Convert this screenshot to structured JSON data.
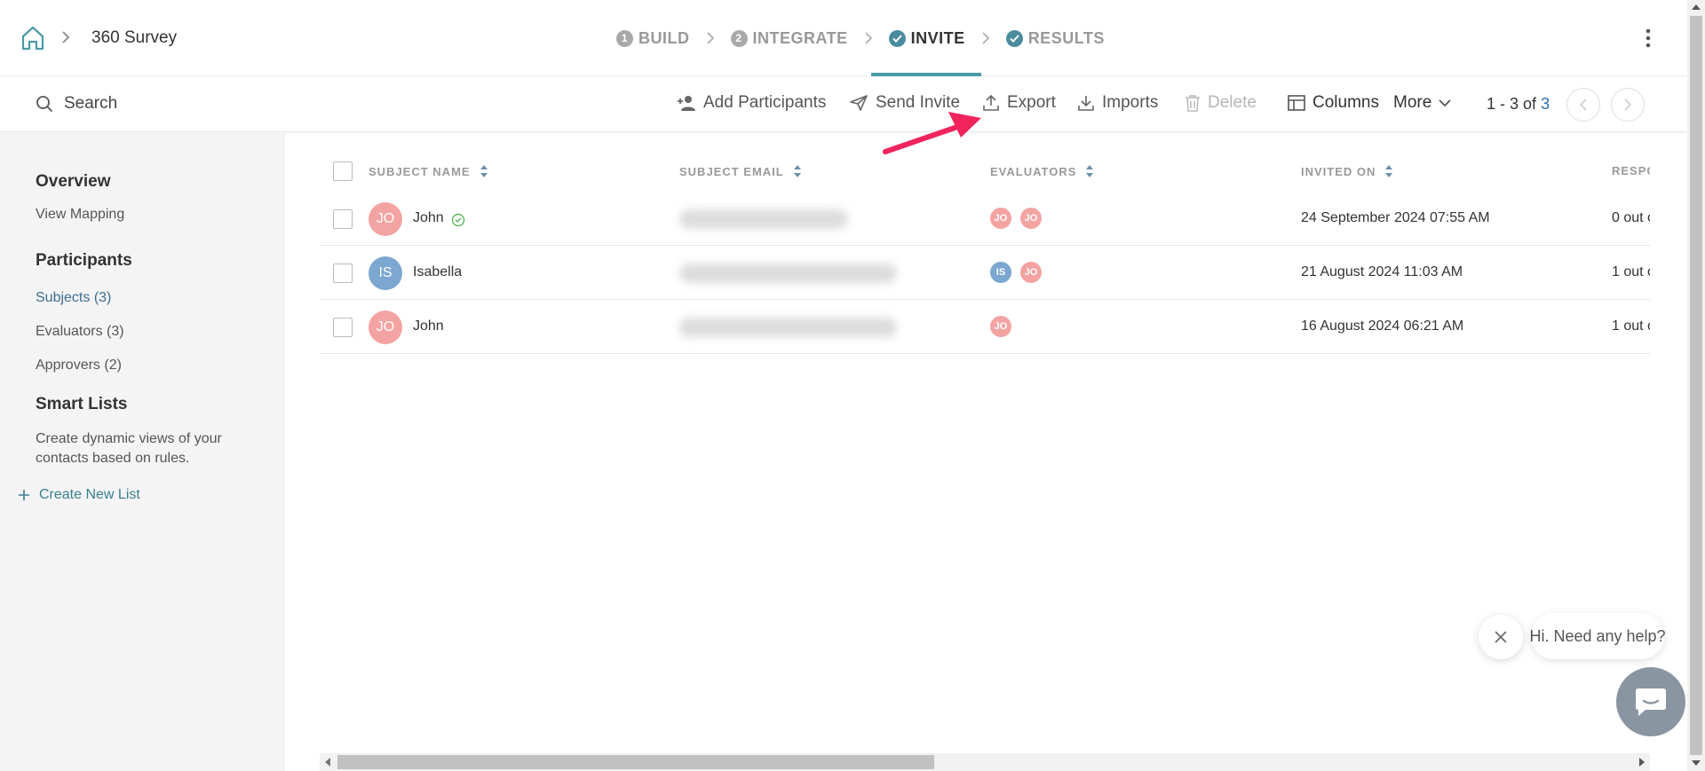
{
  "header": {
    "title": "360 Survey",
    "steps": [
      {
        "num": "1",
        "label": "BUILD"
      },
      {
        "num": "2",
        "label": "INTEGRATE"
      },
      {
        "label": "INVITE"
      },
      {
        "label": "RESULTS"
      }
    ]
  },
  "toolbar": {
    "search": "Search",
    "add_participants": "Add Participants",
    "send_invite": "Send Invite",
    "export": "Export",
    "imports": "Imports",
    "delete": "Delete",
    "columns": "Columns",
    "more": "More",
    "pager_range": "1 - 3",
    "pager_of": "of",
    "pager_total": "3"
  },
  "sidebar": {
    "overview": "Overview",
    "view_mapping": "View Mapping",
    "participants": "Participants",
    "subjects": "Subjects (3)",
    "evaluators": "Evaluators (3)",
    "approvers": "Approvers (2)",
    "smart_lists": "Smart Lists",
    "smart_desc": "Create dynamic views of your contacts based on rules.",
    "create_new_list": "Create New List"
  },
  "table": {
    "columns": [
      "SUBJECT NAME",
      "SUBJECT EMAIL",
      "EVALUATORS",
      "INVITED ON",
      "RESPO"
    ],
    "rows": [
      {
        "initials": "JO",
        "name": "John",
        "evaluators": [
          "JO",
          "JO"
        ],
        "invited_on": "24 September 2024 07:55 AM",
        "responses": "0 out o"
      },
      {
        "initials": "IS",
        "name": "Isabella",
        "evaluators": [
          "IS",
          "JO"
        ],
        "invited_on": "21 August 2024 11:03 AM",
        "responses": "1 out o"
      },
      {
        "initials": "JO",
        "name": "John",
        "evaluators": [
          "JO"
        ],
        "invited_on": "16 August 2024 06:21 AM",
        "responses": "1 out o"
      }
    ]
  },
  "help": {
    "message": "Hi. Need any help?"
  },
  "colors": {
    "accent": "#4a9aa8",
    "pink_avatar": "#f4a3a3",
    "blue_avatar": "#7ba7d1",
    "arrow": "#f0245c",
    "link": "#3c6e93"
  }
}
